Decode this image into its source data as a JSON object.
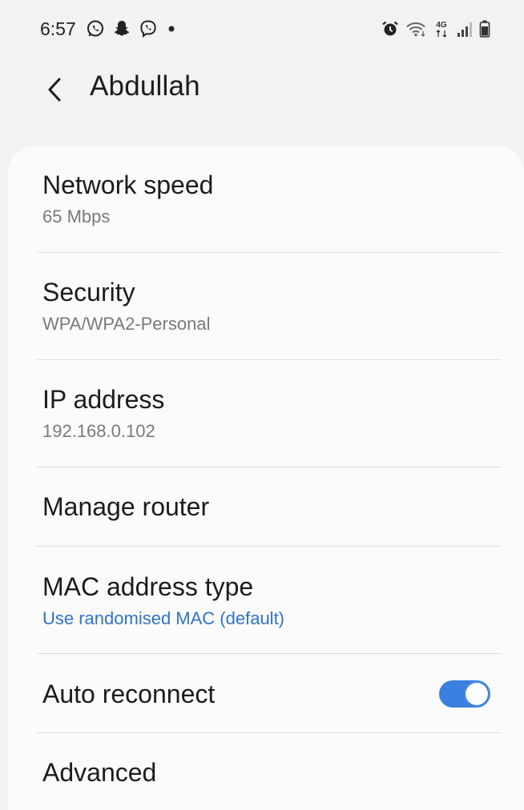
{
  "status_bar": {
    "time": "6:57",
    "left_icons": [
      "whatsapp-icon",
      "snapchat-icon",
      "viber-icon",
      "notification-dot-icon"
    ],
    "right_icons": [
      "alarm-icon",
      "wifi-icon",
      "4g-icon",
      "signal-icon",
      "battery-icon"
    ],
    "network_label": "4G"
  },
  "header": {
    "back_icon": "chevron-left-icon",
    "title": "Abdullah"
  },
  "items": [
    {
      "title": "Network speed",
      "subtitle": "65 Mbps"
    },
    {
      "title": "Security",
      "subtitle": "WPA/WPA2-Personal"
    },
    {
      "title": "IP address",
      "subtitle": "192.168.0.102"
    },
    {
      "title": "Manage router"
    },
    {
      "title": "MAC address type",
      "subtitle": "Use randomised MAC (default)"
    },
    {
      "title": "Auto reconnect",
      "toggle_on": true
    },
    {
      "title": "Advanced"
    }
  ],
  "colors": {
    "accent": "#3b7fe0",
    "link": "#2f74c9",
    "background": "#f2f2f2",
    "card": "#fbfbfb"
  }
}
